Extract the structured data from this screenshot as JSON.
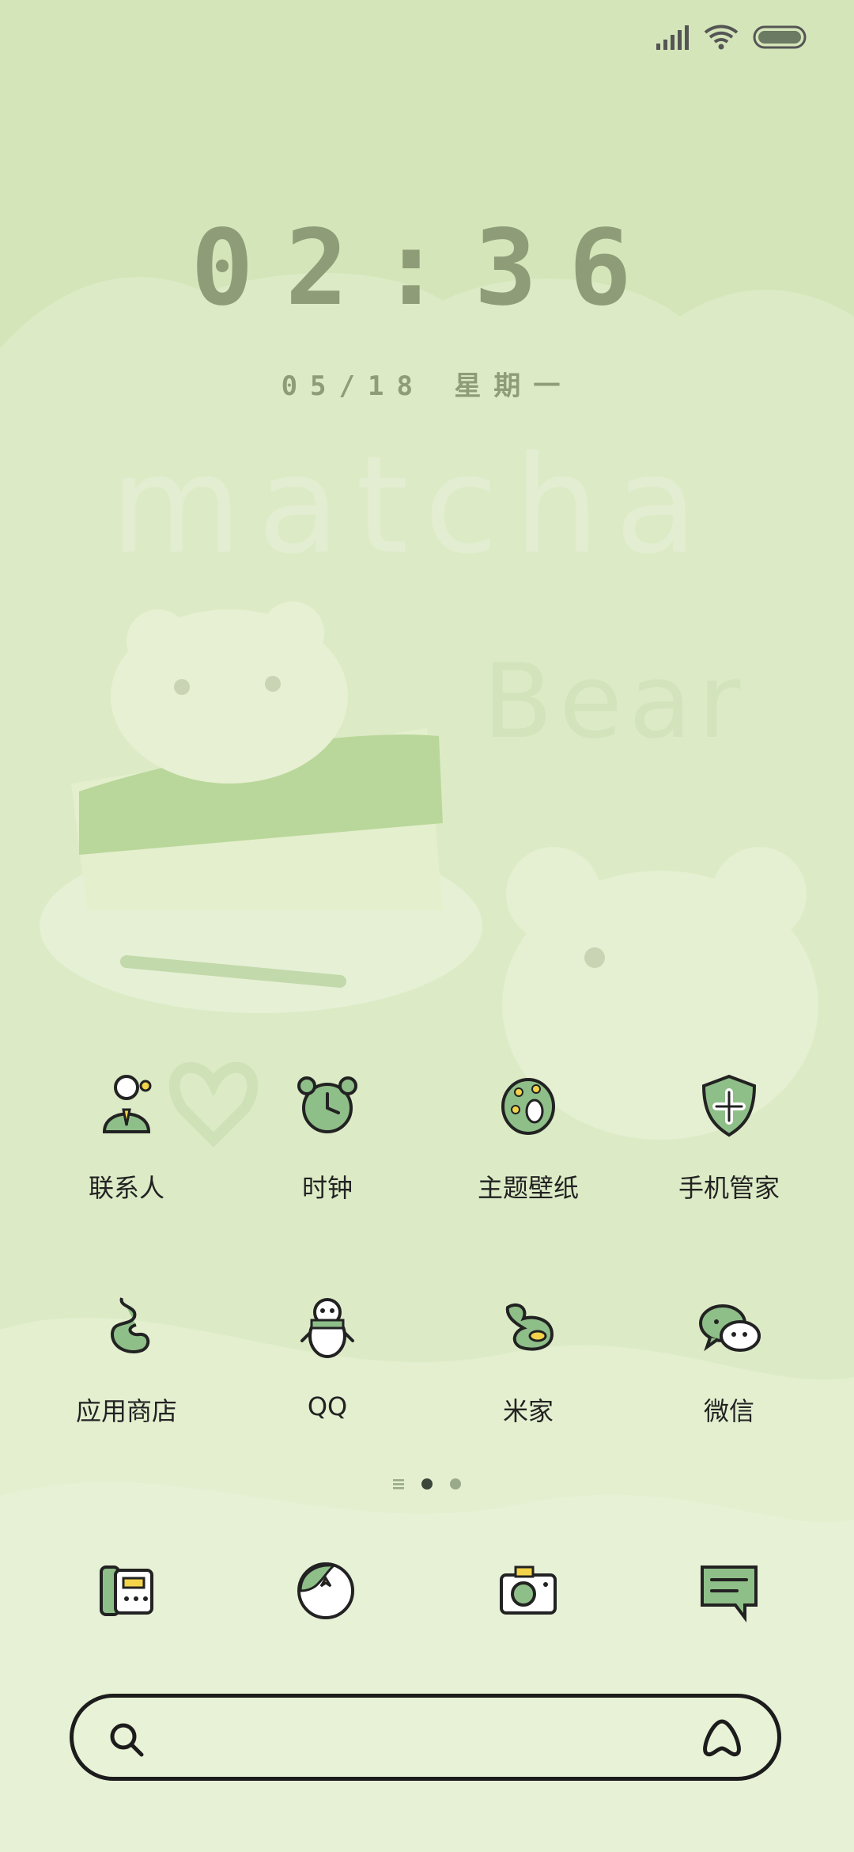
{
  "status_bar": {
    "signal_icon": "signal-bars-icon",
    "wifi_icon": "wifi-icon",
    "battery_icon": "battery-icon",
    "battery_level": 1.0
  },
  "lockclock": {
    "time": "02:36",
    "date": "05/18 星期一"
  },
  "wallpaper_text": {
    "line1": "matcha",
    "line2": "Bear"
  },
  "apps": [
    {
      "label": "联系人",
      "icon": "contacts-person-icon"
    },
    {
      "label": "时钟",
      "icon": "alarm-clock-icon"
    },
    {
      "label": "主题壁纸",
      "icon": "theme-egg-icon"
    },
    {
      "label": "手机管家",
      "icon": "security-shield-icon"
    },
    {
      "label": "应用商店",
      "icon": "app-store-icon"
    },
    {
      "label": "QQ",
      "icon": "qq-penguin-icon"
    },
    {
      "label": "米家",
      "icon": "mijia-icon"
    },
    {
      "label": "微信",
      "icon": "wechat-icon"
    }
  ],
  "pager": {
    "pages": 3,
    "active": 1
  },
  "dock": [
    {
      "icon": "phone-icon"
    },
    {
      "icon": "browser-icon"
    },
    {
      "icon": "camera-icon"
    },
    {
      "icon": "messages-icon"
    }
  ],
  "search": {
    "placeholder": "",
    "icon": "search-icon",
    "assistant_icon": "assistant-icon"
  },
  "colors": {
    "background": "#dcebc6",
    "accent_green": "#8fbf88",
    "clock_text": "#8e9d78"
  }
}
